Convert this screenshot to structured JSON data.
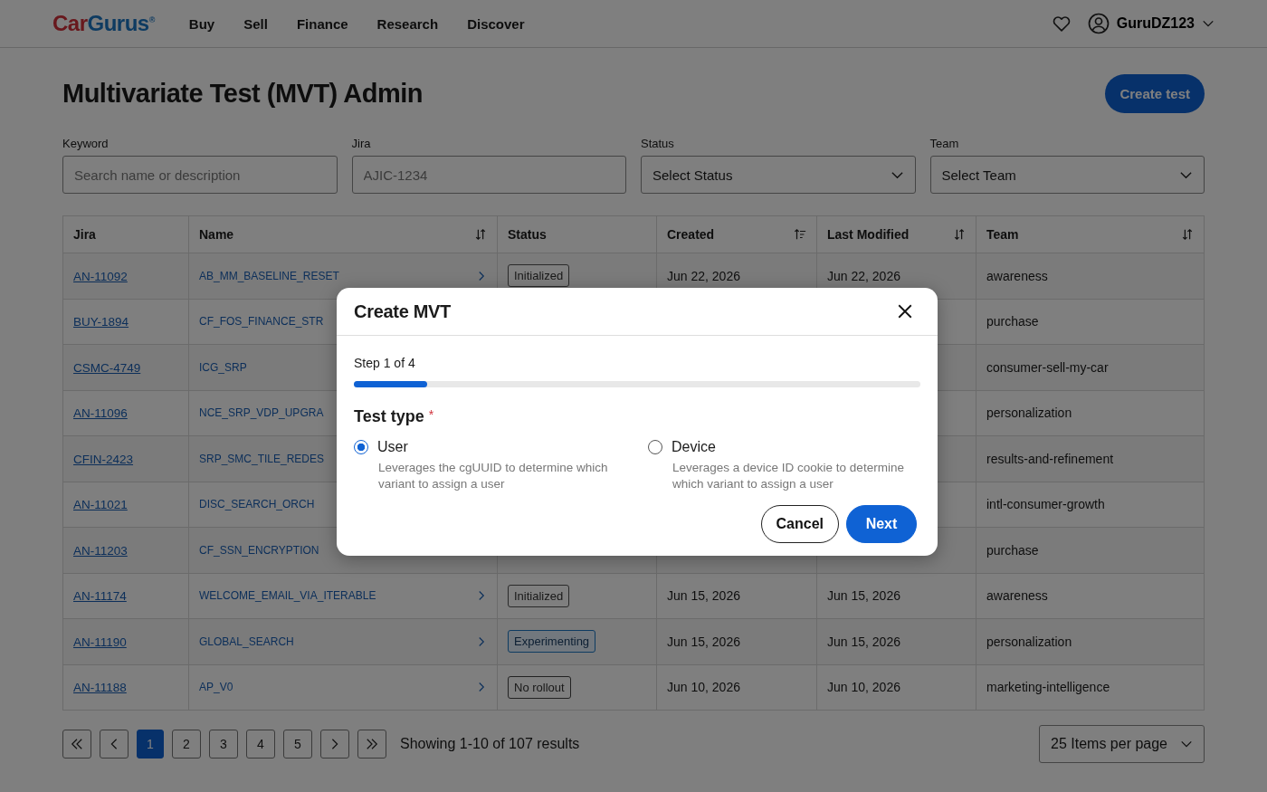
{
  "nav": {
    "logo": {
      "first": "Car",
      "second": "Gurus",
      "mark": "®"
    },
    "links": [
      "Buy",
      "Sell",
      "Finance",
      "Research",
      "Discover"
    ],
    "user": "GuruDZ123"
  },
  "page": {
    "title": "Multivariate Test (MVT) Admin",
    "create_button": "Create test"
  },
  "filters": [
    {
      "label": "Keyword",
      "kind": "text",
      "placeholder": "Search name or description"
    },
    {
      "label": "Jira",
      "kind": "text",
      "placeholder": "AJIC-1234"
    },
    {
      "label": "Status",
      "kind": "select",
      "value": "Select Status"
    },
    {
      "label": "Team",
      "kind": "select",
      "value": "Select Team"
    }
  ],
  "table": {
    "columns": [
      {
        "label": "Jira",
        "kind": "plain"
      },
      {
        "label": "Name",
        "kind": "sortable"
      },
      {
        "label": "Status",
        "kind": "plain"
      },
      {
        "label": "Created",
        "kind": "sorted"
      },
      {
        "label": "Last Modified",
        "kind": "sortable"
      },
      {
        "label": "Team",
        "kind": "sortable"
      }
    ],
    "rows": [
      {
        "jira": "AN-11092",
        "name": "AB_MM_BASELINE_RESET",
        "chevron": true,
        "status": {
          "label": "Initialized",
          "kind": "initialized"
        },
        "created": "Jun 22, 2026",
        "modified": "Jun 22, 2026",
        "team": "awareness"
      },
      {
        "jira": "BUY-1894",
        "name": "CF_FOS_FINANCE_STR",
        "team": "purchase"
      },
      {
        "jira": "CSMC-4749",
        "name": "ICG_SRP",
        "team": "consumer-sell-my-car"
      },
      {
        "jira": "AN-11096",
        "name": "NCE_SRP_VDP_UPGRA",
        "team": "personalization"
      },
      {
        "jira": "CFIN-2423",
        "name": "SRP_SMC_TILE_REDES",
        "team": "results-and-refinement"
      },
      {
        "jira": "AN-11021",
        "name": "DISC_SEARCH_ORCH",
        "team": "intl-consumer-growth"
      },
      {
        "jira": "AN-11203",
        "name": "CF_SSN_ENCRYPTION",
        "team": "purchase"
      },
      {
        "jira": "AN-11174",
        "name": "WELCOME_EMAIL_VIA_ITERABLE",
        "chevron": true,
        "status": {
          "label": "Initialized",
          "kind": "initialized"
        },
        "created": "Jun 15, 2026",
        "modified": "Jun 15, 2026",
        "team": "awareness"
      },
      {
        "jira": "AN-11190",
        "name": "GLOBAL_SEARCH",
        "chevron": true,
        "status": {
          "label": "Experimenting",
          "kind": "experimenting"
        },
        "created": "Jun 15, 2026",
        "modified": "Jun 15, 2026",
        "team": "personalization"
      },
      {
        "jira": "AN-11188",
        "name": "AP_V0",
        "chevron": true,
        "status": {
          "label": "No rollout",
          "kind": "no_rollout"
        },
        "created": "Jun 10, 2026",
        "modified": "Jun 10, 2026",
        "team": "marketing-intelligence"
      }
    ]
  },
  "pagination": {
    "pages": [
      {
        "label": "1",
        "selected": true
      },
      {
        "label": "2",
        "selected": false
      },
      {
        "label": "3",
        "selected": false
      },
      {
        "label": "4",
        "selected": false
      },
      {
        "label": "5",
        "selected": false
      }
    ],
    "summary": "Showing 1-10 of 107 results",
    "per_page": "25 Items per page"
  },
  "modal": {
    "title": "Create MVT",
    "step": "Step 1 of 4",
    "level": 0.13,
    "section": "Test type",
    "required": "*",
    "options": [
      {
        "label": "User",
        "description": "Leverages the cgUUID to determine which variant to assign a user",
        "selected": true
      },
      {
        "label": "Device",
        "description": "Leverages a device ID cookie to determine which variant to assign a user",
        "selected": false
      }
    ],
    "buttons": [
      {
        "label": "Cancel",
        "kind": "secondary"
      },
      {
        "label": "Next",
        "kind": "primary"
      }
    ]
  }
}
